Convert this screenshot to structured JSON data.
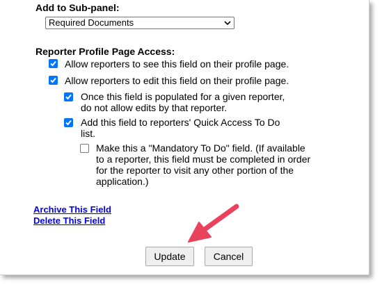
{
  "subpanel": {
    "label": "Add to Sub-panel:",
    "selected": "Required Documents"
  },
  "access": {
    "label": "Reporter Profile Page Access:",
    "options": [
      {
        "text": "Allow reporters to see this field on their profile page.",
        "checked": true
      },
      {
        "text": "Allow reporters to edit this field on their profile page.",
        "checked": true
      },
      {
        "text": "Once this field is populated for a given reporter, do not allow edits by that reporter.",
        "checked": true
      },
      {
        "text": "Add this field to reporters' Quick Access To Do list.",
        "checked": true
      },
      {
        "text": "Make this a \"Mandatory To Do\" field. (If available to a reporter, this field must be completed in order for the reporter to visit any other portion of the application.)",
        "checked": false
      }
    ]
  },
  "links": {
    "archive": "Archive This Field",
    "delete": "Delete This Field"
  },
  "buttons": {
    "update": "Update",
    "cancel": "Cancel"
  },
  "colors": {
    "checkbox": "#0075ff",
    "link": "#0000ee",
    "arrow": "#e8435a"
  }
}
